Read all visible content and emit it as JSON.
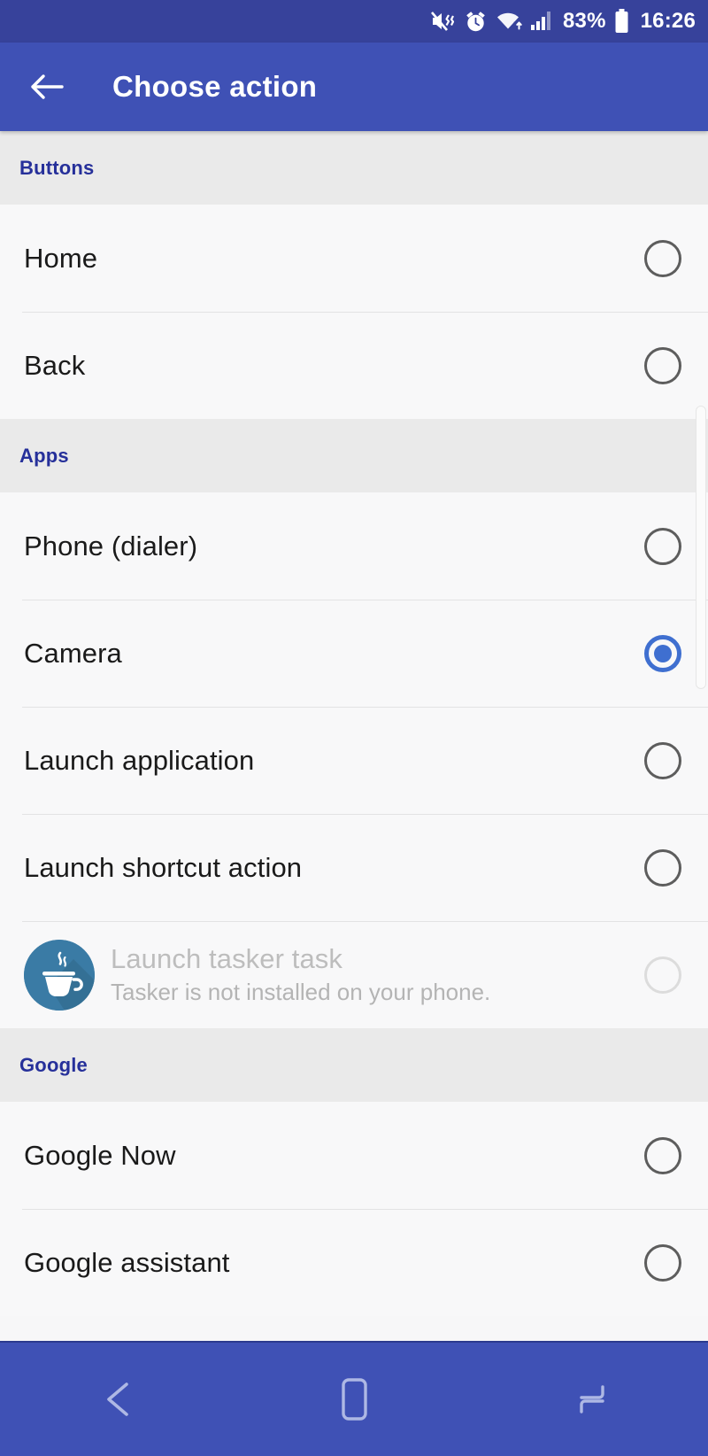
{
  "status_bar": {
    "icons": [
      "mute-vibrate-icon",
      "alarm-icon",
      "wifi-icon",
      "signal-icon",
      "battery-icon"
    ],
    "battery_percent": "83%",
    "clock": "16:26"
  },
  "toolbar": {
    "back_icon": "back-arrow-icon",
    "title": "Choose action"
  },
  "colors": {
    "toolbar": "#3f51b5",
    "status_bar": "#37429b",
    "section_header_bg": "#eaeaea",
    "section_header_text": "#26309a",
    "accent": "#3f6fd0",
    "tasker_icon_bg": "#3a7ba5",
    "row_bg": "#f8f8f9",
    "divider": "#e3e3e4",
    "disabled_text": "#bdbdbd"
  },
  "sections": [
    {
      "title": "Buttons",
      "rows": [
        {
          "title": "Home",
          "subtitle": null,
          "selected": false,
          "disabled": false,
          "icon": null
        },
        {
          "title": "Back",
          "subtitle": null,
          "selected": false,
          "disabled": false,
          "icon": null
        }
      ]
    },
    {
      "title": "Apps",
      "rows": [
        {
          "title": "Phone (dialer)",
          "subtitle": null,
          "selected": false,
          "disabled": false,
          "icon": null
        },
        {
          "title": "Camera",
          "subtitle": null,
          "selected": true,
          "disabled": false,
          "icon": null
        },
        {
          "title": "Launch application",
          "subtitle": null,
          "selected": false,
          "disabled": false,
          "icon": null
        },
        {
          "title": "Launch shortcut action",
          "subtitle": null,
          "selected": false,
          "disabled": false,
          "icon": null
        },
        {
          "title": "Launch tasker task",
          "subtitle": "Tasker is not installed on your phone.",
          "selected": false,
          "disabled": true,
          "icon": "coffee-cup-icon"
        }
      ]
    },
    {
      "title": "Google",
      "rows": [
        {
          "title": "Google Now",
          "subtitle": null,
          "selected": false,
          "disabled": false,
          "icon": null
        },
        {
          "title": "Google assistant",
          "subtitle": null,
          "selected": false,
          "disabled": false,
          "icon": null
        }
      ]
    }
  ],
  "nav_bar": {
    "buttons": [
      {
        "name": "back-nav-icon"
      },
      {
        "name": "home-nav-icon"
      },
      {
        "name": "recents-nav-icon"
      }
    ]
  }
}
